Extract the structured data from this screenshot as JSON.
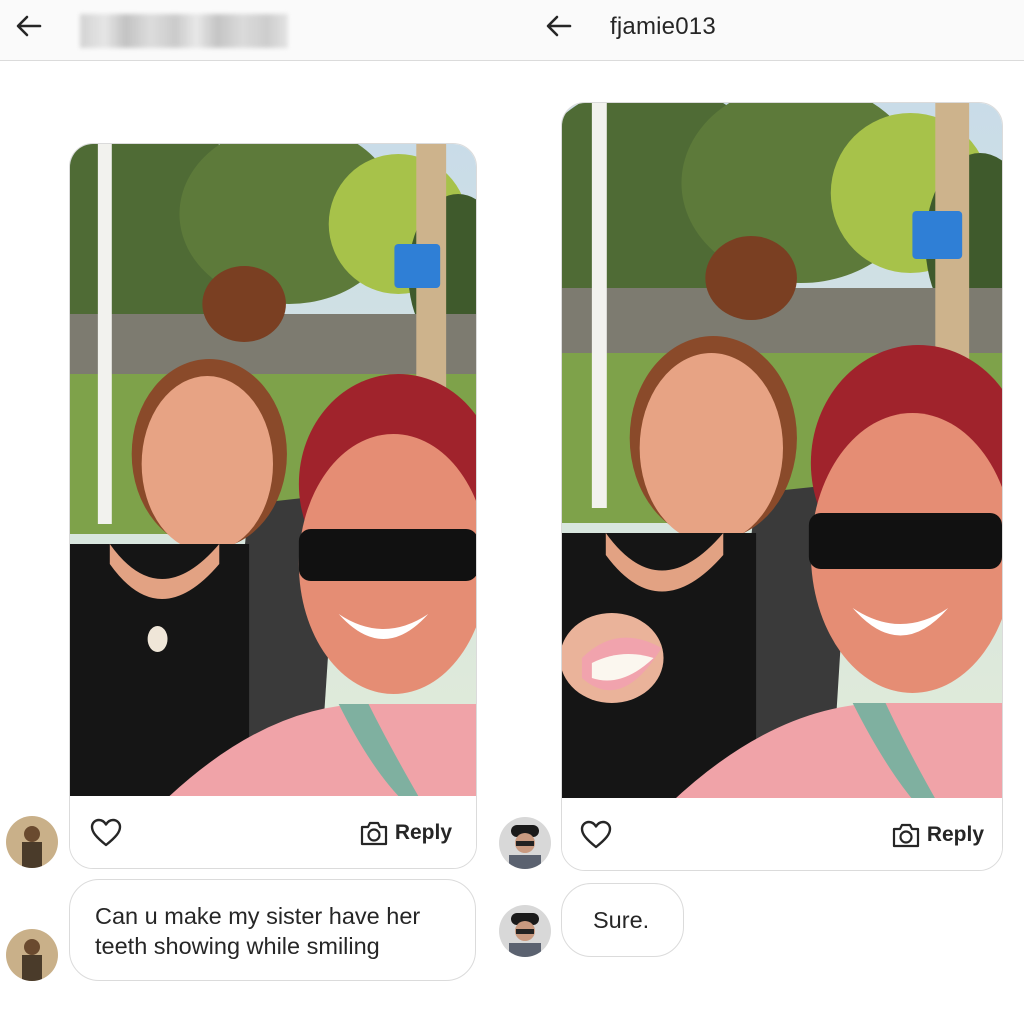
{
  "left_panel": {
    "header": {
      "back_icon": "arrow-left-icon",
      "title_blurred": true
    },
    "photo_message": {
      "like_icon": "heart-outline-icon",
      "reply_icon": "camera-icon",
      "reply_label": "Reply"
    },
    "text_message": {
      "text_line1": "Can u make my sister have her",
      "text_line2": "teeth showing while smiling"
    }
  },
  "right_panel": {
    "header": {
      "back_icon": "arrow-left-icon",
      "username": "fjamie013"
    },
    "photo_message": {
      "like_icon": "heart-outline-icon",
      "reply_icon": "camera-icon",
      "reply_label": "Reply"
    },
    "text_message": {
      "text": "Sure."
    }
  },
  "colors": {
    "background": "#ffffff",
    "header_bg": "#fafafa",
    "border": "#dbdbdb",
    "text": "#262626"
  }
}
